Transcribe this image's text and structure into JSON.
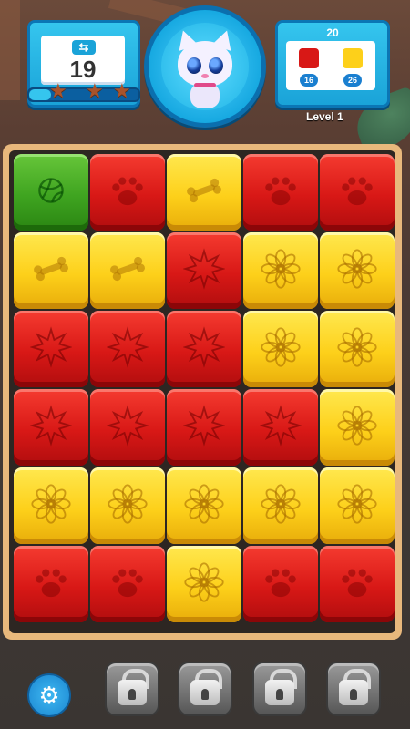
{
  "hud": {
    "moves": "19",
    "stars": [
      "★",
      "★",
      "★"
    ],
    "star_progress": 0.2,
    "goal_total": "20",
    "goals": [
      {
        "color": "#d81816",
        "remaining": "16"
      },
      {
        "color": "#fdd01a",
        "remaining": "26"
      }
    ],
    "level_label": "Level 1"
  },
  "board": {
    "rows": [
      [
        "green-ball",
        "red-paw",
        "yellow-bone",
        "red-paw",
        "red-paw"
      ],
      [
        "yellow-bone",
        "yellow-bone",
        "red-star",
        "yellow-flower",
        "yellow-flower"
      ],
      [
        "red-star",
        "red-star",
        "red-star",
        "yellow-flower",
        "yellow-flower"
      ],
      [
        "red-star",
        "red-star",
        "red-star",
        "red-star",
        "yellow-flower"
      ],
      [
        "yellow-flower",
        "yellow-flower",
        "yellow-flower",
        "yellow-flower",
        "yellow-flower"
      ],
      [
        "red-paw",
        "red-paw",
        "yellow-flower",
        "red-paw",
        "red-paw"
      ]
    ]
  },
  "toolbar": {
    "settings_icon": "gear-icon",
    "boosters": [
      "locked",
      "locked",
      "locked",
      "locked"
    ]
  },
  "colors": {
    "red": "#d81816",
    "yellow": "#fdd01a",
    "green": "#3fa420",
    "hud_blue": "#1aa3d8"
  }
}
